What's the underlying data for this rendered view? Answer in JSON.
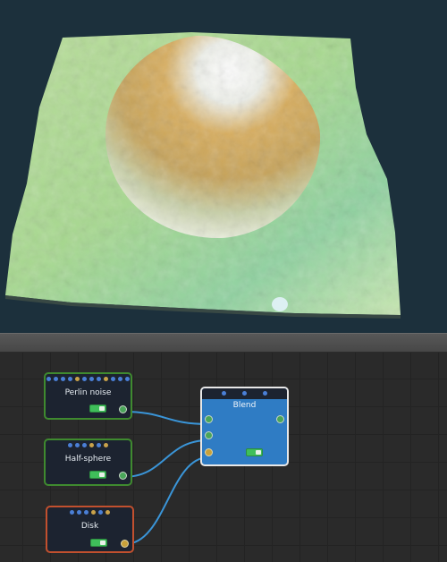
{
  "viewport": {
    "scene": "terrain-3d-view",
    "palette": {
      "background": "#1c303c",
      "grass": "#9fd38a",
      "sand": "#d6a956",
      "snow": "#f0f4f2"
    }
  },
  "graph": {
    "nodes": {
      "perlin": {
        "title": "Perlin noise",
        "enabled": true,
        "border_color": "#3f8a2f"
      },
      "half_sphere": {
        "title": "Half-sphere",
        "enabled": true,
        "border_color": "#3f8a2f"
      },
      "disk": {
        "title": "Disk",
        "enabled": true,
        "border_color": "#c2502e"
      },
      "blend": {
        "title": "Blend",
        "enabled": true,
        "border_color": "#e8e8e8",
        "fill": "#2f7cc4"
      }
    },
    "wire_color": "#3a95d8"
  }
}
